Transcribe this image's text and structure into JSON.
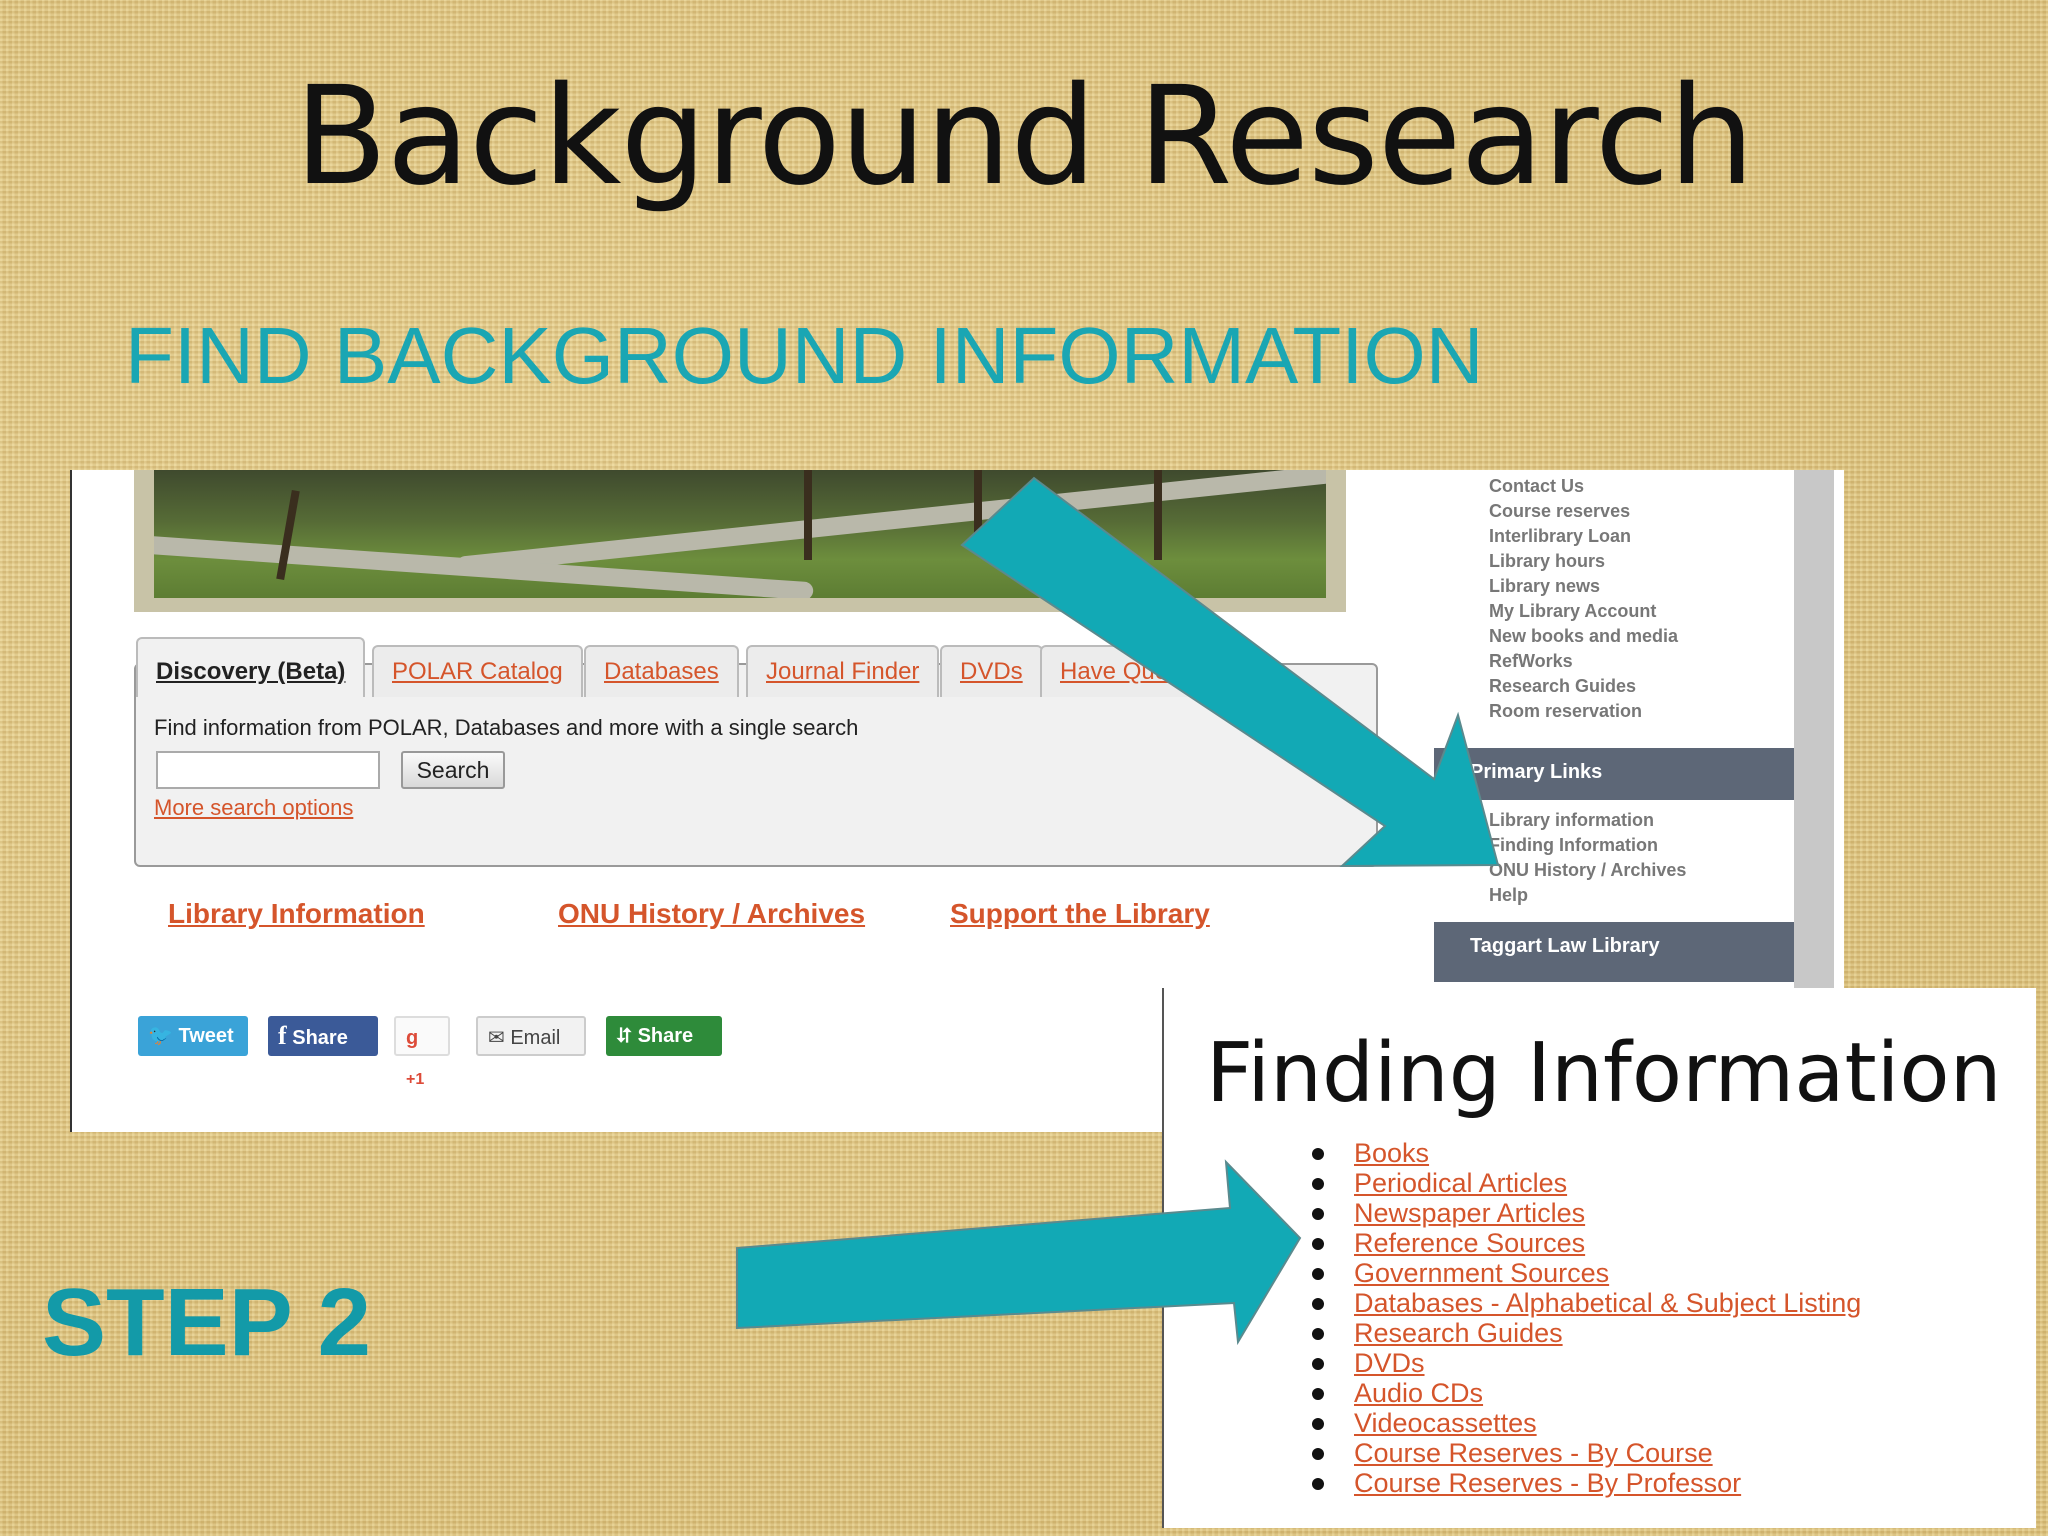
{
  "slide": {
    "title": "Background Research",
    "subtitle": "FIND BACKGROUND INFORMATION",
    "step": "STEP 2",
    "accent_color": "#1aa6b3"
  },
  "website": {
    "tabs": [
      "Discovery (Beta)",
      "POLAR Catalog",
      "Databases",
      "Journal Finder",
      "DVDs",
      "Have Ques"
    ],
    "active_tab": "Discovery (Beta)",
    "search_description": "Find information from POLAR, Databases and more with a single search",
    "search_input_value": "",
    "search_button": "Search",
    "more_search": "More search options",
    "links": [
      "Library Information",
      "ONU History / Archives",
      "Support the Library"
    ],
    "share_buttons": [
      "Tweet",
      "Share",
      "+1",
      "Email",
      "Share"
    ],
    "link_color": "#d5552b"
  },
  "sidebar": {
    "items": [
      "Contact Us",
      "Course reserves",
      "Interlibrary Loan",
      "Library hours",
      "Library news",
      "My Library Account",
      "New books and media",
      "RefWorks",
      "Research Guides",
      "Room reservation"
    ],
    "primary_heading": "Primary Links",
    "primary_items": [
      "Library information",
      "Finding Information",
      "ONU History / Archives",
      "Help"
    ],
    "law_heading": "Taggart Law Library"
  },
  "finding_information": {
    "title": "Finding Information",
    "items": [
      "Books",
      "Periodical Articles",
      "Newspaper Articles",
      "Reference Sources",
      "Government Sources",
      "Databases - Alphabetical & Subject Listing",
      "Research Guides",
      "DVDs",
      "Audio CDs",
      "Videocassettes",
      "Course Reserves - By Course",
      "Course Reserves - By Professor"
    ]
  }
}
